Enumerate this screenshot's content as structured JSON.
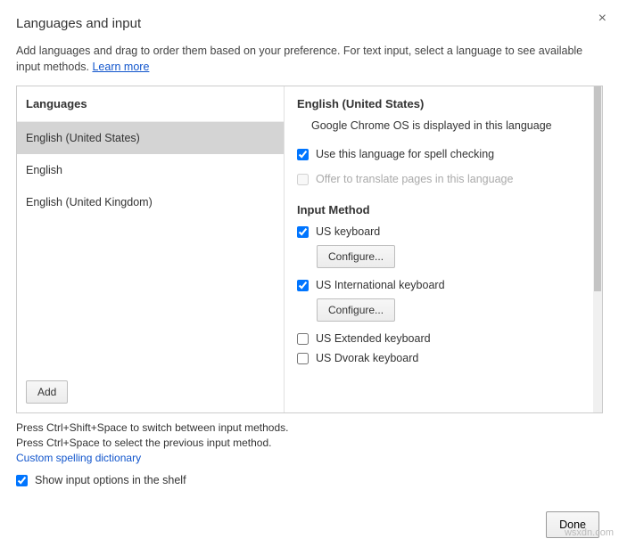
{
  "title": "Languages and input",
  "description_prefix": "Add languages and drag to order them based on your preference. For text input, select a language to see available input methods. ",
  "learn_more": "Learn more",
  "left": {
    "header": "Languages",
    "items": [
      "English (United States)",
      "English",
      "English (United Kingdom)"
    ],
    "add_label": "Add"
  },
  "right": {
    "header": "English (United States)",
    "display_info": "Google Chrome OS is displayed in this language",
    "spell_label": "Use this language for spell checking",
    "translate_label": "Offer to translate pages in this language",
    "input_method_header": "Input Method",
    "configure_label": "Configure...",
    "methods": [
      {
        "name": "US keyboard",
        "checked": true,
        "configurable": true
      },
      {
        "name": "US International keyboard",
        "checked": true,
        "configurable": true
      },
      {
        "name": "US Extended keyboard",
        "checked": false,
        "configurable": false
      },
      {
        "name": "US Dvorak keyboard",
        "checked": false,
        "configurable": false
      }
    ]
  },
  "footer": {
    "line1": "Press Ctrl+Shift+Space to switch between input methods.",
    "line2": "Press Ctrl+Space to select the previous input method.",
    "dict_link": "Custom spelling dictionary",
    "shelf_label": "Show input options in the shelf",
    "done_label": "Done"
  },
  "watermark": "wsxdn.com"
}
